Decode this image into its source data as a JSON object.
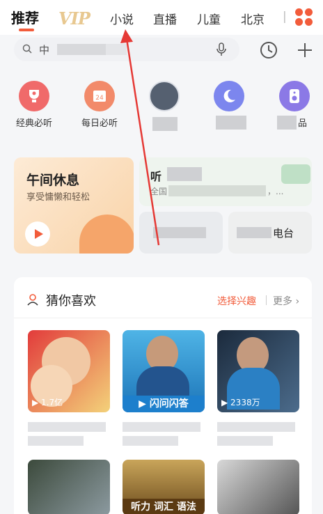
{
  "tabs": [
    {
      "label": "推荐",
      "active": true
    },
    {
      "label": "VIP",
      "active": false
    },
    {
      "label": "小说",
      "active": false
    },
    {
      "label": "直播",
      "active": false
    },
    {
      "label": "儿童",
      "active": false
    },
    {
      "label": "北京",
      "active": false
    }
  ],
  "accent_color": "#f25c3b",
  "search": {
    "prefix": "中"
  },
  "quick_items": [
    {
      "label": "经典必听",
      "icon": "trophy-icon",
      "color": "#f06a6a"
    },
    {
      "label": "每日必听",
      "icon": "calendar-icon",
      "color": "#f28a6a"
    },
    {
      "label": "",
      "icon": "avatar-icon",
      "color": "#556070"
    },
    {
      "label": "",
      "icon": "moon-icon",
      "color": "#7c86ee"
    },
    {
      "label": "品",
      "icon": "speaker-icon",
      "color": "#8b79e6"
    }
  ],
  "banner": {
    "nap_title": "午间休息",
    "nap_subtitle": "享受慵懒和轻松",
    "listen_title": "听",
    "listen_subtitle": "全国",
    "listen_suffix": "，...",
    "radio_label": "电台"
  },
  "recommend": {
    "title": "猜你喜欢",
    "pick_label": "选择兴趣",
    "more_label": "更多 ›"
  },
  "covers": [
    {
      "plays": "▶ 1.7亿",
      "caption": ""
    },
    {
      "plays": "",
      "caption": "▶ 闪问闪答"
    },
    {
      "plays": "▶ 2338万",
      "caption": ""
    },
    {
      "plays": "",
      "caption": ""
    },
    {
      "plays": "",
      "caption": "听力 词汇 语法"
    },
    {
      "plays": "",
      "caption": ""
    }
  ]
}
